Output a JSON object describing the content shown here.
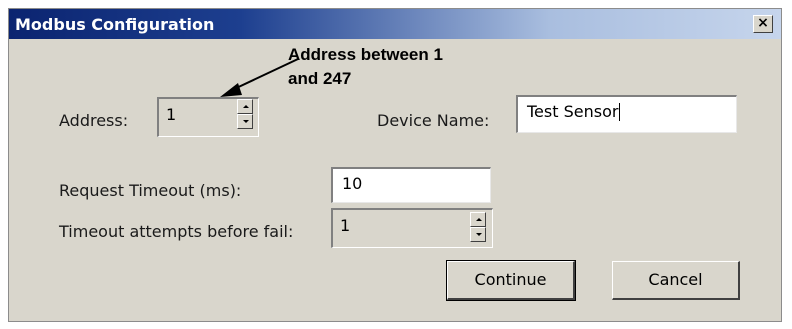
{
  "window": {
    "title": "Modbus Configuration",
    "close_label": "×"
  },
  "annotation": {
    "line1": "Address between 1",
    "line2": "and 247",
    "arrow_icon": "arrow-icon"
  },
  "address": {
    "label": "Address:",
    "value": "1"
  },
  "device_name": {
    "label": "Device Name:",
    "value": "Test Sensor"
  },
  "request_timeout": {
    "label": "Request Timeout (ms):",
    "value": "10"
  },
  "timeout_attempts": {
    "label": "Timeout attempts before fail:",
    "value": "1"
  },
  "buttons": {
    "continue_label": "Continue",
    "cancel_label": "Cancel"
  },
  "colors": {
    "dialog_bg": "#d9d6cc",
    "title_start": "#0b2470",
    "title_end": "#c6d5ec"
  }
}
